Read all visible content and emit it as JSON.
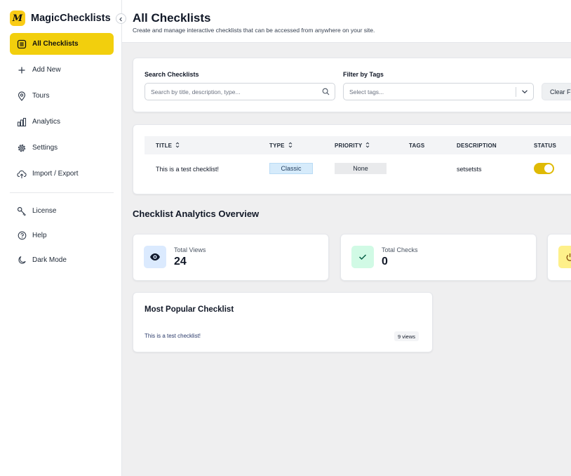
{
  "app": {
    "name": "MagicChecklists",
    "logo_letter": "M",
    "accent": "#f2cf0d"
  },
  "sidebar": {
    "items": [
      {
        "label": "All Checklists",
        "icon": "list-icon",
        "active": true
      },
      {
        "label": "Add New",
        "icon": "plus-icon"
      },
      {
        "label": "Tours",
        "icon": "map-pin-icon"
      },
      {
        "label": "Analytics",
        "icon": "bar-chart-icon"
      },
      {
        "label": "Settings",
        "icon": "gear-icon"
      },
      {
        "label": "Import / Export",
        "icon": "upload-icon"
      }
    ],
    "secondary": [
      {
        "label": "License",
        "icon": "key-icon"
      },
      {
        "label": "Help",
        "icon": "help-circle-icon"
      },
      {
        "label": "Dark Mode",
        "icon": "moon-icon"
      }
    ]
  },
  "header": {
    "title": "All Checklists",
    "subtitle": "Create and manage interactive checklists that can be accessed from anywhere on your site."
  },
  "filters": {
    "search_label": "Search Checklists",
    "search_placeholder": "Search by title, description, type...",
    "tags_label": "Filter by Tags",
    "tags_placeholder": "Select tags...",
    "clear_label": "Clear F"
  },
  "table": {
    "columns": [
      "TITLE",
      "TYPE",
      "PRIORITY",
      "TAGS",
      "DESCRIPTION",
      "STATUS"
    ],
    "rows": [
      {
        "title": "This is a test checklist!",
        "type": "Classic",
        "priority": "None",
        "tags": "",
        "description": "setsetsts",
        "status_on": true
      }
    ]
  },
  "analytics": {
    "title": "Checklist Analytics Overview",
    "stats": [
      {
        "label": "Total Views",
        "value": "24",
        "icon": "eye-icon",
        "color": "#dbeafe"
      },
      {
        "label": "Total Checks",
        "value": "0",
        "icon": "check-icon",
        "color": "#d1fae5"
      },
      {
        "label": "",
        "value": "",
        "icon": "power-icon",
        "color": "#fef08a"
      }
    ]
  },
  "popular": {
    "title": "Most Popular Checklist",
    "item": "This is a test checklist!",
    "views": "9 views"
  }
}
